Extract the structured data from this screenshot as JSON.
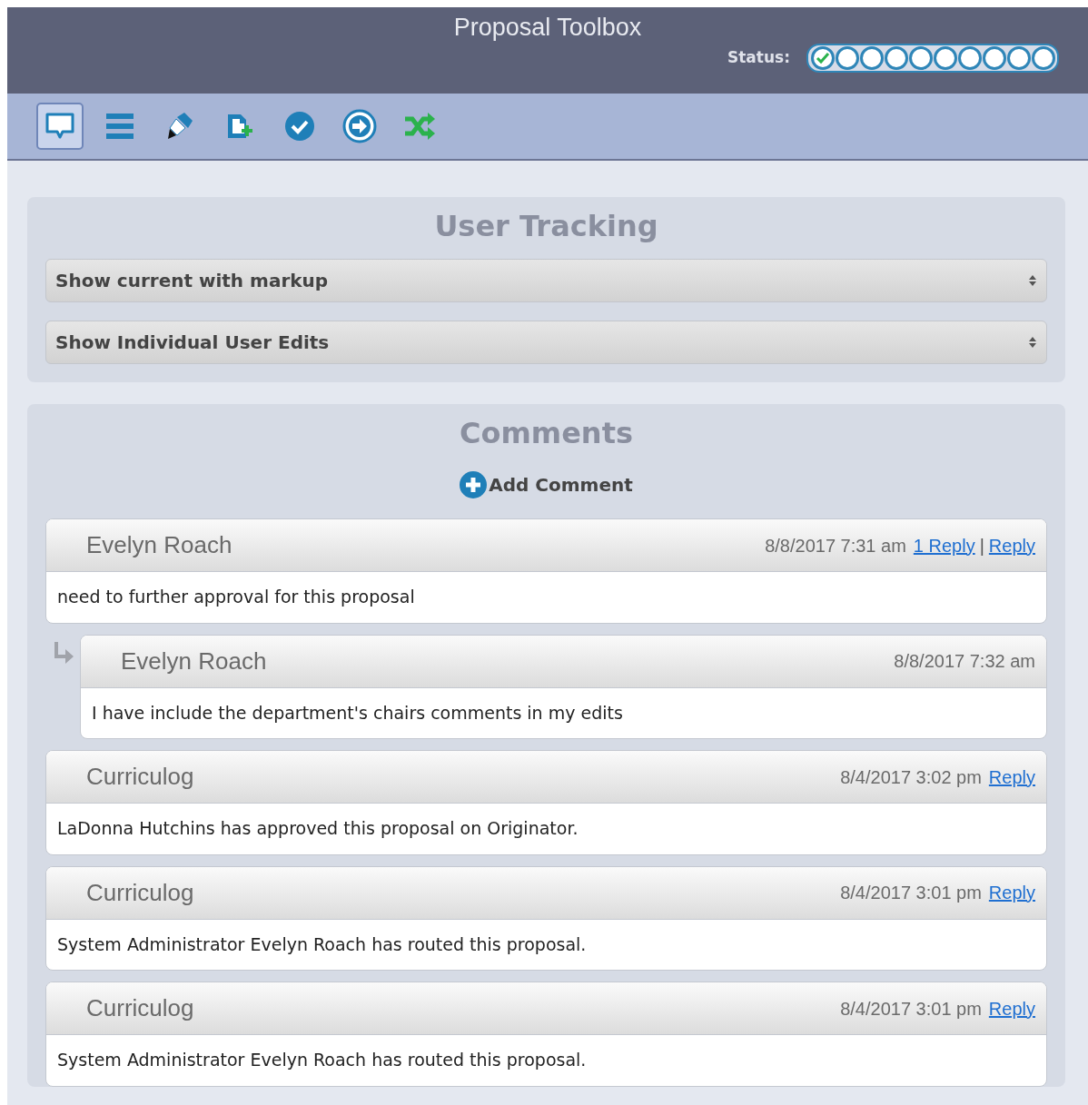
{
  "header": {
    "title": "Proposal Toolbox",
    "status_label": "Status:",
    "steps": [
      {
        "done": true
      },
      {
        "done": false
      },
      {
        "done": false
      },
      {
        "done": false
      },
      {
        "done": false
      },
      {
        "done": false
      },
      {
        "done": false
      },
      {
        "done": false
      },
      {
        "done": false
      },
      {
        "done": false
      }
    ]
  },
  "toolbar": [
    {
      "kind": "comment",
      "selected": true
    },
    {
      "kind": "list",
      "selected": false
    },
    {
      "kind": "pen",
      "selected": false
    },
    {
      "kind": "add-file",
      "selected": false
    },
    {
      "kind": "check",
      "selected": false
    },
    {
      "kind": "arrow",
      "selected": false
    },
    {
      "kind": "shuffle",
      "selected": false
    }
  ],
  "user_tracking": {
    "title": "User Tracking",
    "selects": [
      {
        "value": "Show current with markup"
      },
      {
        "value": "Show Individual User Edits"
      }
    ]
  },
  "comments": {
    "title": "Comments",
    "add_label": "Add Comment",
    "link_separator": "|",
    "items": [
      {
        "author": "Evelyn Roach",
        "time": "8/8/2017 7:31 am",
        "links": [
          "1 Reply",
          "Reply"
        ],
        "body": "need to further approval for this proposal",
        "replies": [
          {
            "author": "Evelyn Roach",
            "time": "8/8/2017 7:32 am",
            "body": "I have include the department's chairs comments in my edits"
          }
        ]
      },
      {
        "author": "Curriculog",
        "time": "8/4/2017 3:02 pm",
        "links": [
          "Reply"
        ],
        "body": "LaDonna Hutchins has approved this proposal on Originator."
      },
      {
        "author": "Curriculog",
        "time": "8/4/2017 3:01 pm",
        "links": [
          "Reply"
        ],
        "body": "System Administrator Evelyn Roach has routed this proposal."
      },
      {
        "author": "Curriculog",
        "time": "8/4/2017 3:01 pm",
        "links": [
          "Reply"
        ],
        "body": "System Administrator Evelyn Roach has routed this proposal."
      }
    ]
  }
}
